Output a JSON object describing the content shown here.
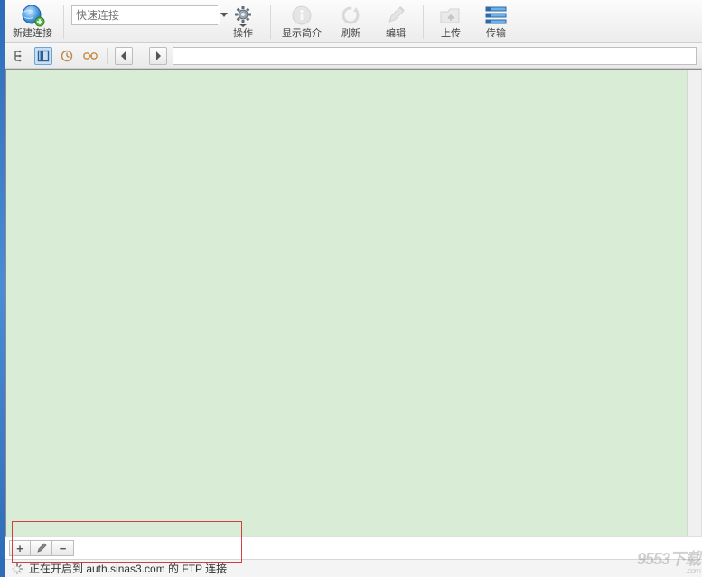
{
  "toolbar": {
    "new_connection": "新建连接",
    "quick_connect_placeholder": "快速连接",
    "actions": "操作",
    "show_intro": "显示简介",
    "refresh": "刷新",
    "edit": "编辑",
    "upload": "上传",
    "transfer": "传输"
  },
  "lowerbar": {
    "add": "+",
    "edit": "/",
    "remove": "−"
  },
  "status": {
    "text": "正在开启到 auth.sinas3.com 的 FTP 连接"
  },
  "watermark": {
    "main": "9553下载",
    "sub": ".com"
  }
}
